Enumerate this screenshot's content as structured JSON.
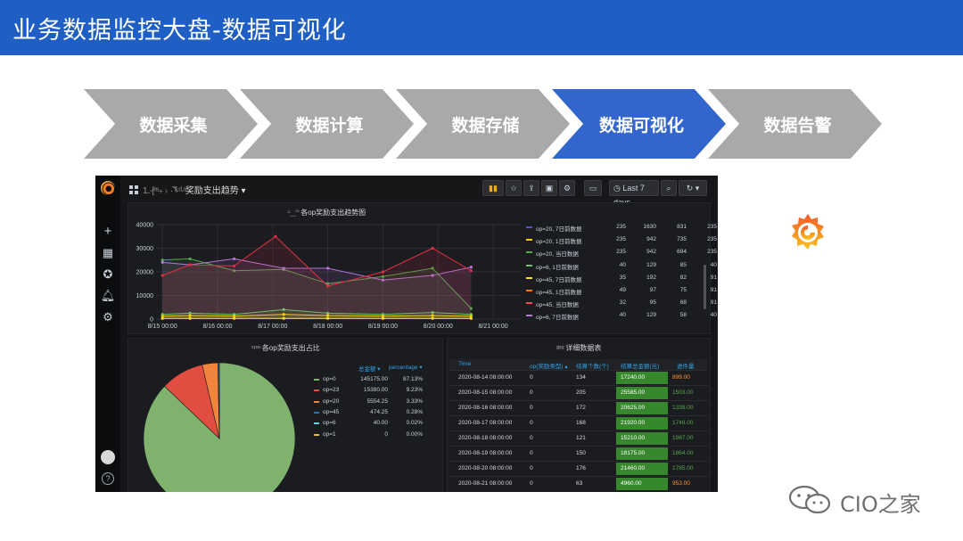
{
  "slide": {
    "title": "业务数据监控大盘-数据可视化",
    "steps": [
      "数据采集",
      "数据计算",
      "数据存储",
      "数据可视化",
      "数据告警"
    ],
    "active_step": 3
  },
  "dashboard": {
    "breadcrumb_blur1": "1..-[ᵉˢ·˫",
    "breadcrumb_blur2": "·˭ᵗˡʲ·ᵈ·ˢ",
    "breadcrumb_title": "奖励支出趋势",
    "breadcrumb_caret": "▾",
    "time_range": "Last 7 days",
    "toolbar_icons": [
      "add-panel",
      "star",
      "share",
      "save",
      "settings",
      "tv-mode",
      "time",
      "zoom",
      "refresh",
      "caret"
    ],
    "line_panel": {
      "title_blur": "ᵓ·‿ᐣᐣ",
      "title": "各op奖励支出趋势图"
    },
    "legend_rows": [
      {
        "name": "op=20, 7日前数据",
        "color": "#5b4fc4",
        "a": "235",
        "b": "1630",
        "c": "831",
        "d": "235"
      },
      {
        "name": "op=20, 1日前数据",
        "color": "#f2cc0c",
        "a": "235",
        "b": "942",
        "c": "735",
        "d": "235"
      },
      {
        "name": "op=20, 当日数据",
        "color": "#56a64b",
        "a": "235",
        "b": "942",
        "c": "694",
        "d": "235"
      },
      {
        "name": "op=6, 1日前数据",
        "color": "#73bf69",
        "a": "40",
        "b": "129",
        "c": "85",
        "d": "40"
      },
      {
        "name": "op=45, 7日前数据",
        "color": "#fade2a",
        "a": "35",
        "b": "192",
        "c": "82",
        "d": "91"
      },
      {
        "name": "op=45, 1日前数据",
        "color": "#ff780a",
        "a": "49",
        "b": "97",
        "c": "75",
        "d": "91"
      },
      {
        "name": "op=45, 当日数据",
        "color": "#f2495c",
        "a": "32",
        "b": "95",
        "c": "68",
        "d": "91"
      },
      {
        "name": "op=6, 7日前数据",
        "color": "#b877d9",
        "a": "40",
        "b": "129",
        "c": "58",
        "d": "40"
      }
    ],
    "pie_panel": {
      "title_blur": "ᵓᶜᵖᵃʳˢ",
      "title": "各op奖励支出占比",
      "col1": "总金额 ▾",
      "col2": "percentage ▾",
      "rows": [
        {
          "name": "op=0",
          "color": "#7eb26d",
          "amount": "145175.00",
          "pct": "87.13%"
        },
        {
          "name": "op=23",
          "color": "#e24d42",
          "amount": "15380.00",
          "pct": "9.23%"
        },
        {
          "name": "op=20",
          "color": "#ef843c",
          "amount": "5554.25",
          "pct": "3.33%"
        },
        {
          "name": "op=45",
          "color": "#1f78c1",
          "amount": "474.25",
          "pct": "0.28%"
        },
        {
          "name": "op=6",
          "color": "#6ed0e0",
          "amount": "40.00",
          "pct": "0.02%"
        },
        {
          "name": "op=1",
          "color": "#eab839",
          "amount": "0",
          "pct": "0.00%"
        }
      ]
    },
    "table_panel": {
      "title_blur": "ᵖ̵ᵗᵃᵉ̵ᶻ",
      "title": "详细数据表",
      "headers": [
        "Time",
        "op(奖励类型) ▴",
        "结算个数(个)",
        "结算总金额(元)",
        "进件量"
      ],
      "rows": [
        {
          "time": "2020-08-14 08:00:00",
          "op": "0",
          "count": "134",
          "amount": "17240.00",
          "progress": "899.00",
          "pcolor": "#ff9830"
        },
        {
          "time": "2020-08-15 08:00:00",
          "op": "0",
          "count": "205",
          "amount": "25585.00",
          "progress": "1503.00",
          "pcolor": "#56a64b"
        },
        {
          "time": "2020-08-16 08:00:00",
          "op": "0",
          "count": "172",
          "amount": "20625.00",
          "progress": "1338.00",
          "pcolor": "#56a64b"
        },
        {
          "time": "2020-08-17 08:00:00",
          "op": "0",
          "count": "168",
          "amount": "21920.00",
          "progress": "1748.00",
          "pcolor": "#56a64b"
        },
        {
          "time": "2020-08-18 08:00:00",
          "op": "0",
          "count": "121",
          "amount": "15210.00",
          "progress": "1987.00",
          "pcolor": "#56a64b"
        },
        {
          "time": "2020-08-19 08:00:00",
          "op": "0",
          "count": "150",
          "amount": "18175.00",
          "progress": "1864.00",
          "pcolor": "#56a64b"
        },
        {
          "time": "2020-08-20 08:00:00",
          "op": "0",
          "count": "176",
          "amount": "21460.00",
          "progress": "1785.00",
          "pcolor": "#56a64b"
        },
        {
          "time": "2020-08-21 08:00:00",
          "op": "0",
          "count": "63",
          "amount": "4960.00",
          "progress": "953.00",
          "pcolor": "#ff9830"
        }
      ]
    }
  },
  "chart_data": [
    {
      "type": "line",
      "title": "各op奖励支出趋势图",
      "x": [
        "8/15 00:00",
        "8/16 00:00",
        "8/17 00:00",
        "8/18 00:00",
        "8/19 00:00",
        "8/20 00:00",
        "8/21 00:00"
      ],
      "ylim": [
        0,
        40000
      ],
      "yticks": [
        0,
        10000,
        20000,
        30000,
        40000
      ],
      "ytick_labels": [
        "0",
        "10000",
        "20000",
        "30000",
        "40000"
      ],
      "grid": true,
      "legend": "right",
      "series": [
        {
          "color": "#56a64b",
          "points": [
            [
              0,
              25000
            ],
            [
              0.5,
              25500
            ],
            [
              1.3,
              20500
            ],
            [
              2.2,
              21000
            ],
            [
              3,
              15000
            ],
            [
              4,
              18000
            ],
            [
              4.9,
              21500
            ],
            [
              5.6,
              4500
            ]
          ]
        },
        {
          "color": "#b877d9",
          "points": [
            [
              0,
              24000
            ],
            [
              0.5,
              23000
            ],
            [
              1.3,
              25500
            ],
            [
              2.2,
              21500
            ],
            [
              3,
              21500
            ],
            [
              4,
              16500
            ],
            [
              4.9,
              18500
            ],
            [
              5.6,
              22000
            ]
          ]
        },
        {
          "color": "#e02f44",
          "points": [
            [
              0,
              18500
            ],
            [
              0.5,
              23000
            ],
            [
              1.3,
              22500
            ],
            [
              2.05,
              35000
            ],
            [
              3,
              14000
            ],
            [
              4,
              20000
            ],
            [
              4.9,
              30000
            ],
            [
              5.6,
              20500
            ]
          ]
        },
        {
          "color": "#73bf69",
          "points": [
            [
              0,
              2000
            ],
            [
              0.5,
              2500
            ],
            [
              1.3,
              2000
            ],
            [
              2.2,
              4000
            ],
            [
              3,
              2500
            ],
            [
              4,
              2000
            ],
            [
              4.9,
              2800
            ],
            [
              5.6,
              2000
            ]
          ]
        },
        {
          "color": "#f2cc0c",
          "points": [
            [
              0,
              1200
            ],
            [
              0.5,
              1500
            ],
            [
              1.3,
              1300
            ],
            [
              2.2,
              2000
            ],
            [
              3,
              1500
            ],
            [
              4,
              1300
            ],
            [
              4.9,
              1500
            ],
            [
              5.6,
              1200
            ]
          ]
        },
        {
          "color": "#fade2a",
          "points": [
            [
              0,
              300
            ],
            [
              0.5,
              300
            ],
            [
              1.3,
              300
            ],
            [
              2.2,
              300
            ],
            [
              3,
              300
            ],
            [
              4,
              300
            ],
            [
              4.9,
              300
            ],
            [
              5.6,
              300
            ]
          ]
        }
      ]
    },
    {
      "type": "pie",
      "title": "各op奖励支出占比",
      "categories": [
        "op=0",
        "op=23",
        "op=20",
        "op=45",
        "op=6",
        "op=1"
      ],
      "values": [
        145175.0,
        15380.0,
        5554.25,
        474.25,
        40.0,
        0
      ],
      "colors": [
        "#7eb26d",
        "#e24d42",
        "#ef843c",
        "#1f78c1",
        "#6ed0e0",
        "#eab839"
      ]
    }
  ]
}
